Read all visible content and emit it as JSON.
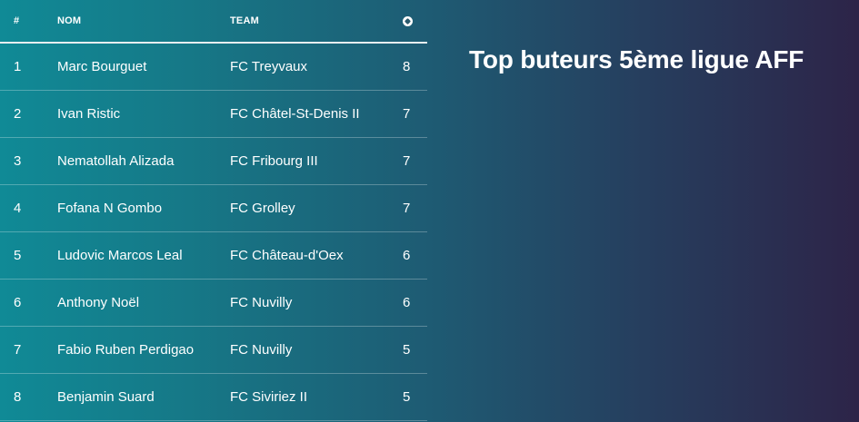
{
  "table": {
    "headers": {
      "num": "#",
      "name": "NOM",
      "team": "TEAM",
      "goals_icon": "soccer-ball-icon"
    },
    "rows": [
      {
        "rank": "1",
        "name": "Marc Bourguet",
        "team": "FC Treyvaux",
        "goals": "8"
      },
      {
        "rank": "2",
        "name": "Ivan Ristic",
        "team": "FC Châtel-St-Denis II",
        "goals": "7"
      },
      {
        "rank": "3",
        "name": "Nematollah Alizada",
        "team": "FC Fribourg III",
        "goals": "7"
      },
      {
        "rank": "4",
        "name": "Fofana N Gombo",
        "team": "FC Grolley",
        "goals": "7"
      },
      {
        "rank": "5",
        "name": "Ludovic Marcos Leal",
        "team": "FC Château-d'Oex",
        "goals": "6"
      },
      {
        "rank": "6",
        "name": "Anthony Noël",
        "team": "FC Nuvilly",
        "goals": "6"
      },
      {
        "rank": "7",
        "name": "Fabio Ruben Perdigao",
        "team": "FC Nuvilly",
        "goals": "5"
      },
      {
        "rank": "8",
        "name": "Benjamin Suard",
        "team": "FC Siviriez II",
        "goals": "5"
      }
    ]
  },
  "title": "Top buteurs 5ème ligue AFF",
  "colors": {
    "gradient_left": "#108a96",
    "gradient_right": "#2d2448",
    "text": "#ffffff"
  }
}
